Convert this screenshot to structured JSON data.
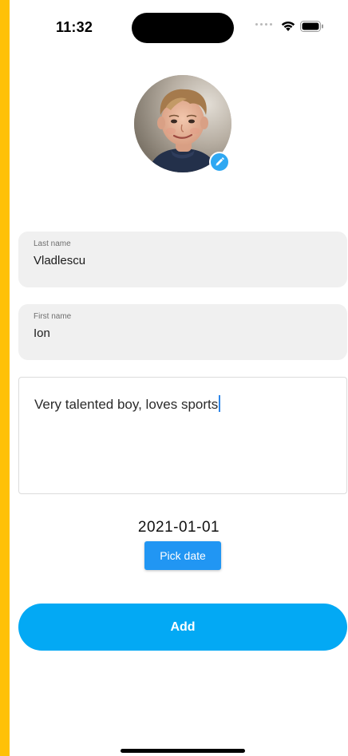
{
  "status_bar": {
    "time": "11:32",
    "wifi_icon": "wifi-icon",
    "battery_icon": "battery-icon"
  },
  "profile": {
    "avatar_icon": "child-photo-avatar",
    "edit_icon": "pencil-icon",
    "badge_color": "#2FA8F2"
  },
  "form": {
    "last_name": {
      "label": "Last name",
      "value": "Vladlescu"
    },
    "first_name": {
      "label": "First name",
      "value": "Ion"
    },
    "notes": {
      "value": "Very talented boy, loves sports"
    }
  },
  "date": {
    "value": "2021-01-01",
    "pick_label": "Pick date"
  },
  "actions": {
    "add_label": "Add",
    "accent_color": "#03A9F4"
  }
}
